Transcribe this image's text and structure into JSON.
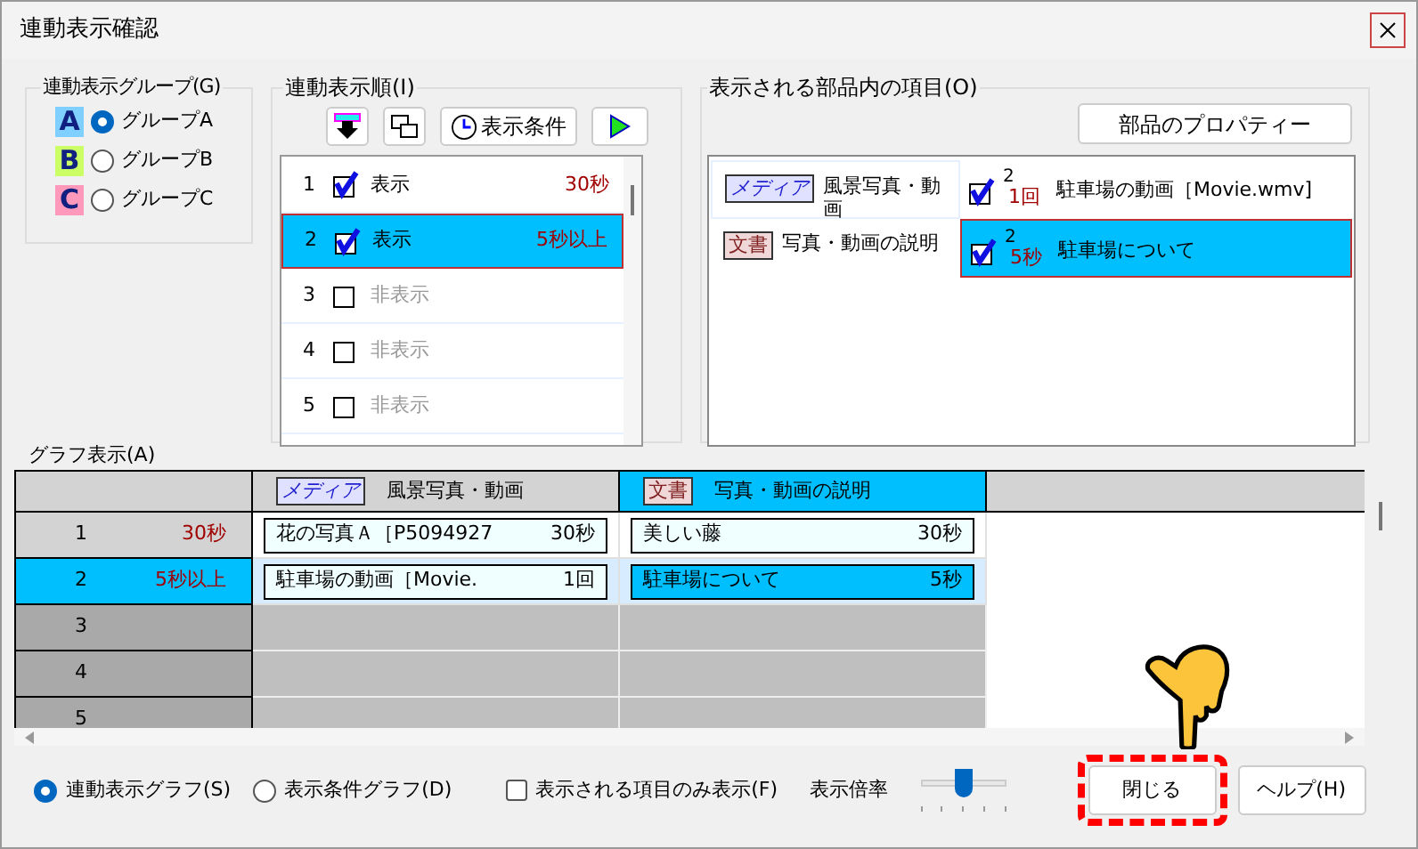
{
  "window": {
    "title": "連動表示確認"
  },
  "group": {
    "title": "連動表示グループ(G)",
    "options": [
      {
        "badge": "A",
        "color": "#7fd0ff",
        "label": "グループA",
        "selected": true
      },
      {
        "badge": "B",
        "color": "#ccff66",
        "label": "グループB",
        "selected": false
      },
      {
        "badge": "C",
        "color": "#ff99bb",
        "label": "グループC",
        "selected": false
      }
    ]
  },
  "order": {
    "title": "連動表示順(I)",
    "toolbar": [
      {
        "kind": "down"
      },
      {
        "kind": "copy"
      },
      {
        "kind": "clock",
        "label": "表示条件"
      },
      {
        "kind": "play"
      }
    ],
    "rows": [
      {
        "number": "1",
        "checked": true,
        "label": "表示",
        "condition": "30秒",
        "selected": false
      },
      {
        "number": "2",
        "checked": true,
        "label": "表示",
        "condition": "5秒以上",
        "selected": true
      },
      {
        "number": "3",
        "checked": false,
        "label": "非表示",
        "selected": false
      },
      {
        "number": "4",
        "checked": false,
        "label": "非表示",
        "selected": false
      },
      {
        "number": "5",
        "checked": false,
        "label": "非表示",
        "selected": false
      }
    ]
  },
  "items": {
    "title": "表示される部品内の項目(O)",
    "property_button": "部品のプロパティー",
    "rows": [
      {
        "tag": "メディア",
        "kind": "media",
        "name": "風景写真・動画",
        "entry": {
          "checked": true,
          "number": "2",
          "count": "1回",
          "label": "駐車場の動画［Movie.wmv]",
          "selected": false
        }
      },
      {
        "tag": "文書",
        "kind": "document",
        "name": "写真・動画の説明",
        "entry": {
          "checked": true,
          "number": "2",
          "count": "5秒",
          "label": "駐車場について",
          "selected": true
        }
      }
    ]
  },
  "graph": {
    "title": "グラフ表示(A)",
    "columns": [
      {
        "tag": "メディア",
        "kind": "media",
        "name": "風景写真・動画",
        "selected": false
      },
      {
        "tag": "文書",
        "kind": "document",
        "name": "写真・動画の説明",
        "selected": true
      }
    ],
    "rows": [
      {
        "number": "1",
        "condition": "30秒",
        "selected": false,
        "active": true,
        "cells": [
          {
            "text": "花の写真Ａ［P5094927",
            "value": "30秒",
            "selected": false
          },
          {
            "text": "美しい藤",
            "value": "30秒",
            "selected": false
          }
        ]
      },
      {
        "number": "2",
        "condition": "5秒以上",
        "selected": true,
        "active": true,
        "cells": [
          {
            "text": "駐車場の動画［Movie.",
            "value": "1回",
            "selected": false
          },
          {
            "text": "駐車場について",
            "value": "5秒",
            "selected": true
          }
        ]
      },
      {
        "number": "3",
        "selected": false,
        "active": false,
        "cells": []
      },
      {
        "number": "4",
        "selected": false,
        "active": false,
        "cells": []
      },
      {
        "number": "5",
        "selected": false,
        "active": false,
        "cells": []
      }
    ]
  },
  "bottom": {
    "graph_modes": [
      {
        "label": "連動表示グラフ(S)",
        "selected": true
      },
      {
        "label": "表示条件グラフ(D)",
        "selected": false
      }
    ],
    "only_shown": {
      "label": "表示される項目のみ表示(F)",
      "checked": false
    },
    "zoom": {
      "label": "表示倍率",
      "level": 0.5
    },
    "buttons": [
      {
        "label": "閉じる",
        "highlighted": true
      },
      {
        "label": "ヘルプ(H)",
        "highlighted": false
      }
    ]
  }
}
